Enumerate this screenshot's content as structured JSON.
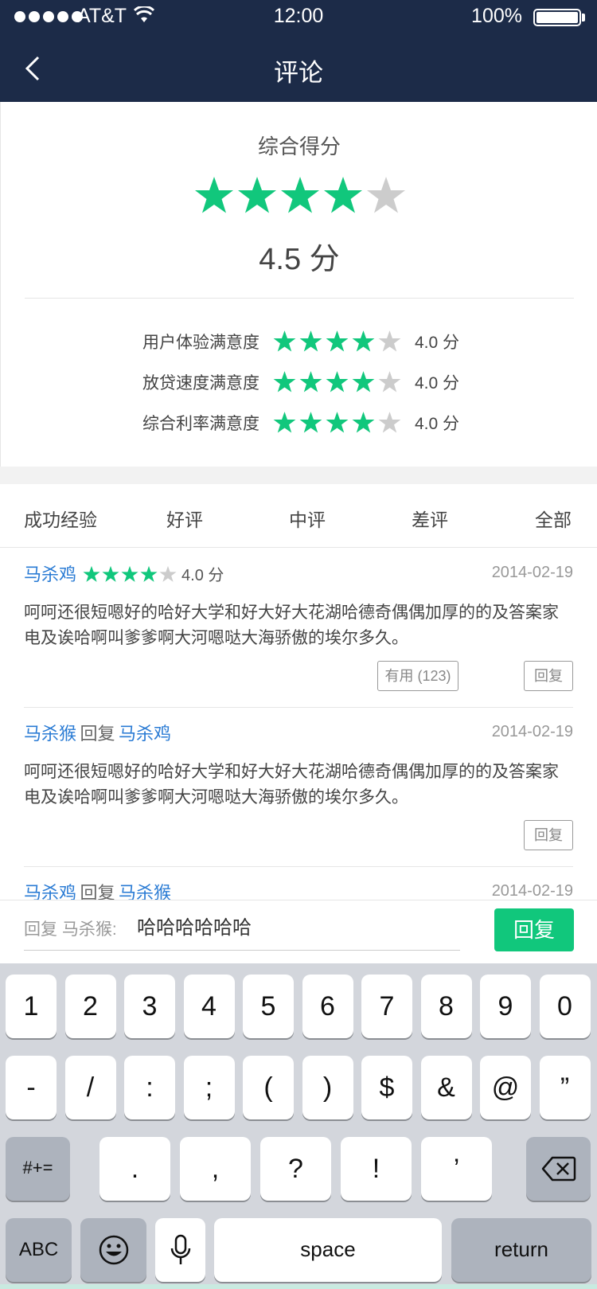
{
  "status_bar": {
    "carrier": "AT&T",
    "time": "12:00",
    "battery": "100%"
  },
  "nav": {
    "title": "评论"
  },
  "score": {
    "title": "综合得分",
    "rating": 4,
    "value_text": "4.5 分",
    "sub_scores": [
      {
        "label": "用户体验满意度",
        "rating": 4,
        "value_text": "4.0 分"
      },
      {
        "label": "放贷速度满意度",
        "rating": 4,
        "value_text": "4.0 分"
      },
      {
        "label": "综合利率满意度",
        "rating": 4,
        "value_text": "4.0 分"
      }
    ]
  },
  "tabs": [
    "成功经验",
    "好评",
    "中评",
    "差评",
    "全部"
  ],
  "comments": [
    {
      "author": "马杀鸡",
      "rating": 4,
      "score_text": "4.0 分",
      "date": "2014-02-19",
      "body": "呵呵还很短嗯好的哈好大学和好大好大花湖哈德奇偶偶加厚的的及答案家电及诶哈啊叫爹爹啊大河嗯哒大海骄傲的埃尔多久。",
      "useful_label": "有用 (123)",
      "reply_label": "回复"
    },
    {
      "author": "马杀猴",
      "reply_word": "回复",
      "reply_to": "马杀鸡",
      "date": "2014-02-19",
      "body": "呵呵还很短嗯好的哈好大学和好大好大花湖哈德奇偶偶加厚的的及答案家电及诶哈啊叫爹爹啊大河嗯哒大海骄傲的埃尔多久。",
      "reply_label": "回复"
    },
    {
      "author": "马杀鸡",
      "reply_word": "回复",
      "reply_to": "马杀猴",
      "date": "2014-02-19"
    }
  ],
  "reply_bar": {
    "prefix": "回复 马杀猴:",
    "input_value": "哈哈哈哈哈哈",
    "send_label": "回复"
  },
  "keyboard": {
    "row1": [
      "1",
      "2",
      "3",
      "4",
      "5",
      "6",
      "7",
      "8",
      "9",
      "0"
    ],
    "row2": [
      "-",
      "/",
      ":",
      ";",
      "(",
      ")",
      "$",
      "&",
      "@",
      "”"
    ],
    "row3_left": "#+=",
    "row3": [
      ".",
      ",",
      "?",
      "!",
      "’"
    ],
    "abc": "ABC",
    "space": "space",
    "return": "return"
  },
  "colors": {
    "nav_bg": "#1c2b48",
    "accent": "#11c77c",
    "link": "#2a7bd4",
    "star_off": "#cccccc"
  },
  "icons": [
    "back-chevron-icon",
    "wifi-icon",
    "battery-icon",
    "star-icon",
    "backspace-icon",
    "emoji-icon",
    "microphone-icon"
  ]
}
